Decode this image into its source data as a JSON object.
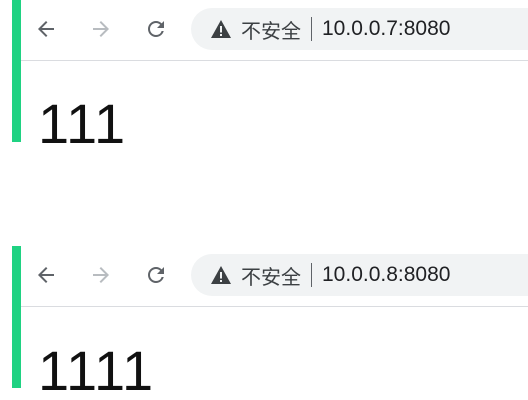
{
  "windows": [
    {
      "security_label": "不安全",
      "url": "10.0.0.7:8080",
      "body_text": "111"
    },
    {
      "security_label": "不安全",
      "url": "10.0.0.8:8080",
      "body_text": "1111"
    }
  ],
  "colors": {
    "accent_bar": "#1fd282",
    "omnibox_bg": "#f1f3f4"
  },
  "icons": {
    "back": "arrow-left",
    "forward": "arrow-right",
    "reload": "reload",
    "security": "warning-triangle"
  }
}
